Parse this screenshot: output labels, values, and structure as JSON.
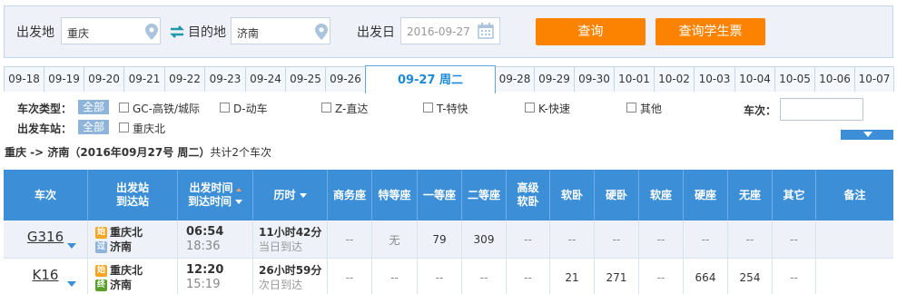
{
  "search": {
    "from_label": "出发地",
    "from_value": "重庆",
    "to_label": "目的地",
    "to_value": "济南",
    "date_label": "出发日",
    "date_value": "2016-09-27",
    "query_button": "查询",
    "student_button": "查询学生票"
  },
  "tabs": [
    {
      "label": "09-18"
    },
    {
      "label": "09-19"
    },
    {
      "label": "09-20"
    },
    {
      "label": "09-21"
    },
    {
      "label": "09-22"
    },
    {
      "label": "09-23"
    },
    {
      "label": "09-24"
    },
    {
      "label": "09-25"
    },
    {
      "label": "09-26"
    },
    {
      "label": "09-27 周二"
    },
    {
      "label": "09-28"
    },
    {
      "label": "09-29"
    },
    {
      "label": "09-30"
    },
    {
      "label": "10-01"
    },
    {
      "label": "10-02"
    },
    {
      "label": "10-03"
    },
    {
      "label": "10-04"
    },
    {
      "label": "10-05"
    },
    {
      "label": "10-06"
    },
    {
      "label": "10-07"
    }
  ],
  "filters": {
    "type_label": "车次类型：",
    "all_label": "全部",
    "types": [
      "GC-高铁/城际",
      "D-动车",
      "Z-直达",
      "T-特快",
      "K-快速",
      "其他"
    ],
    "station_label": "出发车站：",
    "stations": [
      "重庆北"
    ],
    "train_no_label": "车次："
  },
  "summary": {
    "route": "重庆 -> 济南",
    "date_part": "（2016年09月27号  周二）",
    "count": "共计2个车次"
  },
  "table": {
    "headers": {
      "train": "车次",
      "station_1": "出发站",
      "station_2": "到达站",
      "time_1": "出发时间",
      "time_2": "到达时间",
      "duration": "历时",
      "business": "商务座",
      "special": "特等座",
      "first": "一等座",
      "second": "二等座",
      "premium_1": "高级",
      "premium_2": "软卧",
      "soft_sleeper": "软卧",
      "hard_sleeper": "硬卧",
      "soft_seat": "软座",
      "hard_seat": "硬座",
      "no_seat": "无座",
      "other": "其它",
      "note": "备注"
    },
    "rows": [
      {
        "train": "G316",
        "from_badge": "始",
        "from": "重庆北",
        "to_badge": "过",
        "to": "济南",
        "depart": "06:54",
        "arrive": "18:36",
        "duration": "11小时42分",
        "arrival_day": "当日到达",
        "business": "--",
        "special": "无",
        "first": "79",
        "second": "309",
        "premium": "--",
        "soft_sleeper": "--",
        "hard_sleeper": "--",
        "soft_seat": "--",
        "hard_seat": "--",
        "no_seat": "--",
        "other": "--"
      },
      {
        "train": "K16",
        "from_badge": "始",
        "from": "重庆北",
        "to_badge": "终",
        "to": "济南",
        "depart": "12:20",
        "arrive": "15:19",
        "duration": "26小时59分",
        "arrival_day": "次日到达",
        "business": "--",
        "special": "--",
        "first": "--",
        "second": "--",
        "premium": "--",
        "soft_sleeper": "21",
        "hard_sleeper": "271",
        "soft_seat": "--",
        "hard_seat": "664",
        "no_seat": "254",
        "other": "--"
      }
    ]
  }
}
